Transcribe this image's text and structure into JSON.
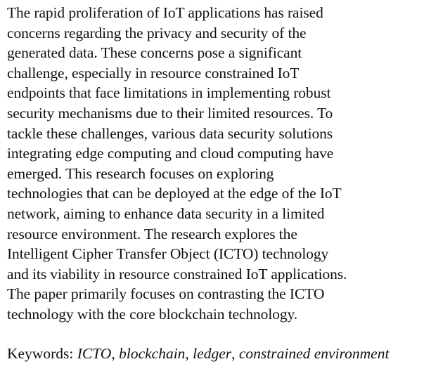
{
  "abstract": {
    "lines": [
      "The rapid proliferation of IoT applications has raised",
      "concerns regarding the privacy and security of the",
      "generated data. These concerns pose a significant",
      "challenge, especially in resource constrained IoT",
      "endpoints that face limitations in implementing robust",
      "security mechanisms due to their limited resources. To",
      "tackle these challenges, various data security solutions",
      "integrating edge computing and cloud computing have",
      "emerged. This research focuses on exploring",
      "technologies that can be deployed at the edge of the IoT",
      "network, aiming to enhance data security in a limited",
      "resource environment. The research explores the",
      "Intelligent Cipher Transfer Object (ICTO) technology",
      "and its viability in resource constrained IoT applications.",
      "The paper primarily focuses on contrasting the ICTO",
      "technology with the core blockchain technology."
    ]
  },
  "keywords": {
    "label": "Keywords:",
    "items": [
      "ICTO",
      "blockchain",
      "ledger",
      "constrained environment"
    ],
    "separator": ","
  }
}
